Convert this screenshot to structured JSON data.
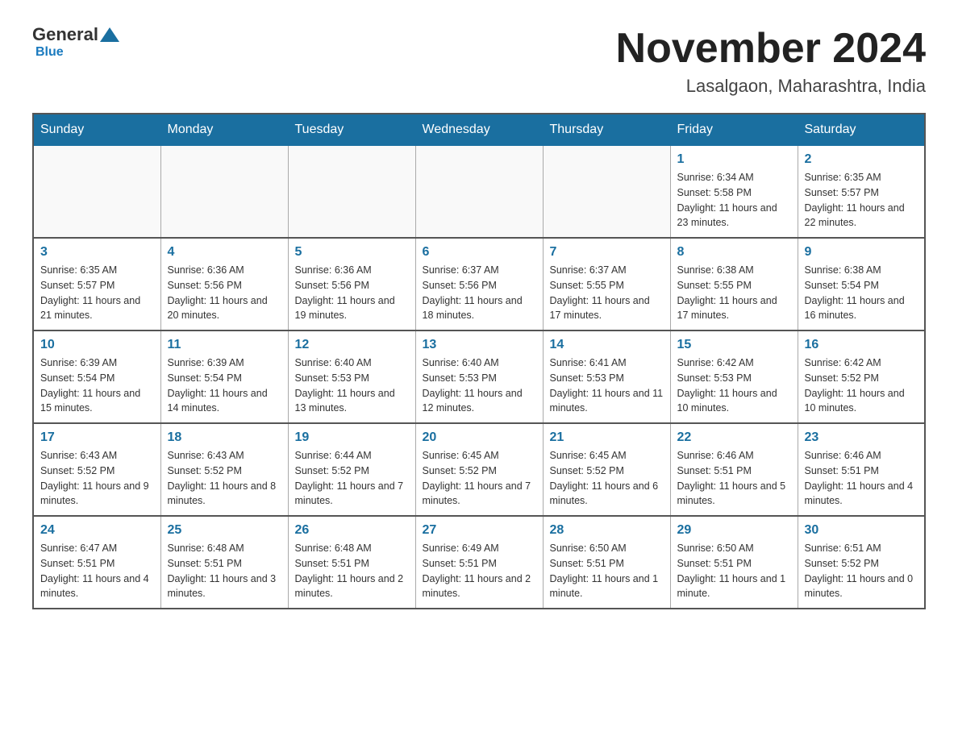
{
  "logo": {
    "general": "General",
    "blue": "Blue"
  },
  "title": {
    "month_year": "November 2024",
    "location": "Lasalgaon, Maharashtra, India"
  },
  "weekdays": [
    "Sunday",
    "Monday",
    "Tuesday",
    "Wednesday",
    "Thursday",
    "Friday",
    "Saturday"
  ],
  "weeks": [
    [
      {
        "day": "",
        "info": ""
      },
      {
        "day": "",
        "info": ""
      },
      {
        "day": "",
        "info": ""
      },
      {
        "day": "",
        "info": ""
      },
      {
        "day": "",
        "info": ""
      },
      {
        "day": "1",
        "info": "Sunrise: 6:34 AM\nSunset: 5:58 PM\nDaylight: 11 hours and 23 minutes."
      },
      {
        "day": "2",
        "info": "Sunrise: 6:35 AM\nSunset: 5:57 PM\nDaylight: 11 hours and 22 minutes."
      }
    ],
    [
      {
        "day": "3",
        "info": "Sunrise: 6:35 AM\nSunset: 5:57 PM\nDaylight: 11 hours and 21 minutes."
      },
      {
        "day": "4",
        "info": "Sunrise: 6:36 AM\nSunset: 5:56 PM\nDaylight: 11 hours and 20 minutes."
      },
      {
        "day": "5",
        "info": "Sunrise: 6:36 AM\nSunset: 5:56 PM\nDaylight: 11 hours and 19 minutes."
      },
      {
        "day": "6",
        "info": "Sunrise: 6:37 AM\nSunset: 5:56 PM\nDaylight: 11 hours and 18 minutes."
      },
      {
        "day": "7",
        "info": "Sunrise: 6:37 AM\nSunset: 5:55 PM\nDaylight: 11 hours and 17 minutes."
      },
      {
        "day": "8",
        "info": "Sunrise: 6:38 AM\nSunset: 5:55 PM\nDaylight: 11 hours and 17 minutes."
      },
      {
        "day": "9",
        "info": "Sunrise: 6:38 AM\nSunset: 5:54 PM\nDaylight: 11 hours and 16 minutes."
      }
    ],
    [
      {
        "day": "10",
        "info": "Sunrise: 6:39 AM\nSunset: 5:54 PM\nDaylight: 11 hours and 15 minutes."
      },
      {
        "day": "11",
        "info": "Sunrise: 6:39 AM\nSunset: 5:54 PM\nDaylight: 11 hours and 14 minutes."
      },
      {
        "day": "12",
        "info": "Sunrise: 6:40 AM\nSunset: 5:53 PM\nDaylight: 11 hours and 13 minutes."
      },
      {
        "day": "13",
        "info": "Sunrise: 6:40 AM\nSunset: 5:53 PM\nDaylight: 11 hours and 12 minutes."
      },
      {
        "day": "14",
        "info": "Sunrise: 6:41 AM\nSunset: 5:53 PM\nDaylight: 11 hours and 11 minutes."
      },
      {
        "day": "15",
        "info": "Sunrise: 6:42 AM\nSunset: 5:53 PM\nDaylight: 11 hours and 10 minutes."
      },
      {
        "day": "16",
        "info": "Sunrise: 6:42 AM\nSunset: 5:52 PM\nDaylight: 11 hours and 10 minutes."
      }
    ],
    [
      {
        "day": "17",
        "info": "Sunrise: 6:43 AM\nSunset: 5:52 PM\nDaylight: 11 hours and 9 minutes."
      },
      {
        "day": "18",
        "info": "Sunrise: 6:43 AM\nSunset: 5:52 PM\nDaylight: 11 hours and 8 minutes."
      },
      {
        "day": "19",
        "info": "Sunrise: 6:44 AM\nSunset: 5:52 PM\nDaylight: 11 hours and 7 minutes."
      },
      {
        "day": "20",
        "info": "Sunrise: 6:45 AM\nSunset: 5:52 PM\nDaylight: 11 hours and 7 minutes."
      },
      {
        "day": "21",
        "info": "Sunrise: 6:45 AM\nSunset: 5:52 PM\nDaylight: 11 hours and 6 minutes."
      },
      {
        "day": "22",
        "info": "Sunrise: 6:46 AM\nSunset: 5:51 PM\nDaylight: 11 hours and 5 minutes."
      },
      {
        "day": "23",
        "info": "Sunrise: 6:46 AM\nSunset: 5:51 PM\nDaylight: 11 hours and 4 minutes."
      }
    ],
    [
      {
        "day": "24",
        "info": "Sunrise: 6:47 AM\nSunset: 5:51 PM\nDaylight: 11 hours and 4 minutes."
      },
      {
        "day": "25",
        "info": "Sunrise: 6:48 AM\nSunset: 5:51 PM\nDaylight: 11 hours and 3 minutes."
      },
      {
        "day": "26",
        "info": "Sunrise: 6:48 AM\nSunset: 5:51 PM\nDaylight: 11 hours and 2 minutes."
      },
      {
        "day": "27",
        "info": "Sunrise: 6:49 AM\nSunset: 5:51 PM\nDaylight: 11 hours and 2 minutes."
      },
      {
        "day": "28",
        "info": "Sunrise: 6:50 AM\nSunset: 5:51 PM\nDaylight: 11 hours and 1 minute."
      },
      {
        "day": "29",
        "info": "Sunrise: 6:50 AM\nSunset: 5:51 PM\nDaylight: 11 hours and 1 minute."
      },
      {
        "day": "30",
        "info": "Sunrise: 6:51 AM\nSunset: 5:52 PM\nDaylight: 11 hours and 0 minutes."
      }
    ]
  ]
}
